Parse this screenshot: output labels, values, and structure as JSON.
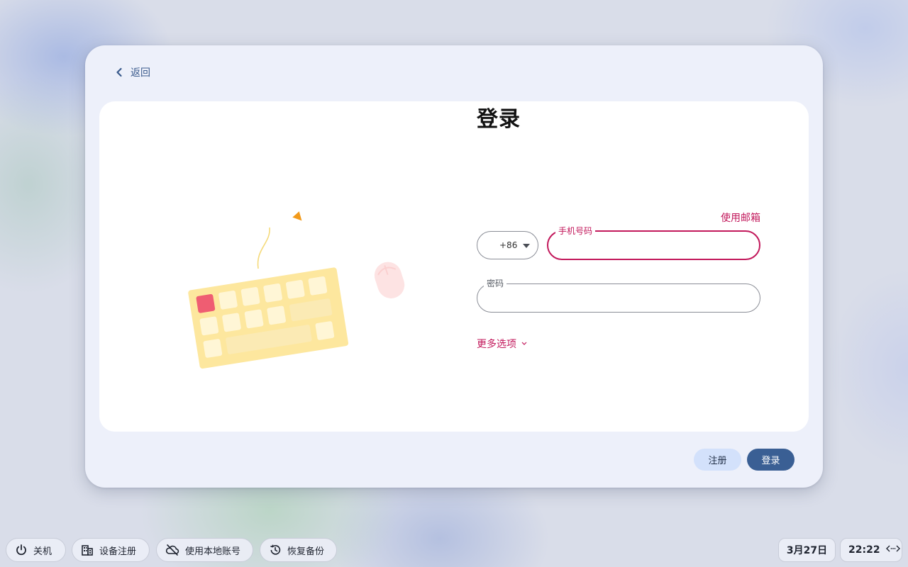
{
  "dialog": {
    "back_label": "返回",
    "title": "登录",
    "use_email_label": "使用邮箱",
    "country_code": "+86",
    "phone_label": "手机号码",
    "phone_value": "",
    "password_label": "密码",
    "password_value": "",
    "more_options_label": "更多选项",
    "register_button": "注册",
    "login_button": "登录"
  },
  "shelf": {
    "shutdown": "关机",
    "enroll_device": "设备注册",
    "local_account": "使用本地账号",
    "restore_backup": "恢复备份"
  },
  "status": {
    "date": "3月27日",
    "time": "22:22"
  },
  "colors": {
    "accent": "#c2185b",
    "primary_button": "#3a5f94",
    "secondary_button": "#d3e1fb",
    "dialog_bg": "#edf0fa"
  },
  "icons": {
    "back": "chevron-left-icon",
    "dropdown": "caret-down-icon",
    "more_options": "chevron-down-icon",
    "shutdown": "power-icon",
    "enroll": "building-icon",
    "local_account": "cloud-off-icon",
    "restore": "history-icon",
    "network": "network-status-icon"
  }
}
